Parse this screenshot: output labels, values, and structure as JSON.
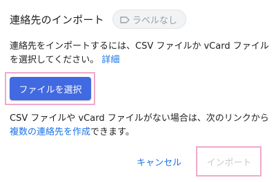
{
  "dialog": {
    "title": "連絡先のインポート",
    "label_chip": {
      "icon": "label-icon",
      "text": "ラベルなし"
    },
    "description_text": "連絡先をインポートするには、CSV ファイルか vCard ファイルを選択してください。",
    "description_link": "詳細",
    "select_file_button": "ファイルを選択",
    "note_text_before": "CSV ファイルや vCard ファイルがない場合は、次のリンクから",
    "note_link": "複数の連絡先を作成",
    "note_text_after": "できます。",
    "cancel_button": "キャンセル",
    "import_button": "インポート"
  },
  "colors": {
    "primary_button": "#4169e1",
    "link": "#1a73e8",
    "highlight_outline": "#f0a8c8",
    "disabled_text": "#c6c9cc"
  }
}
